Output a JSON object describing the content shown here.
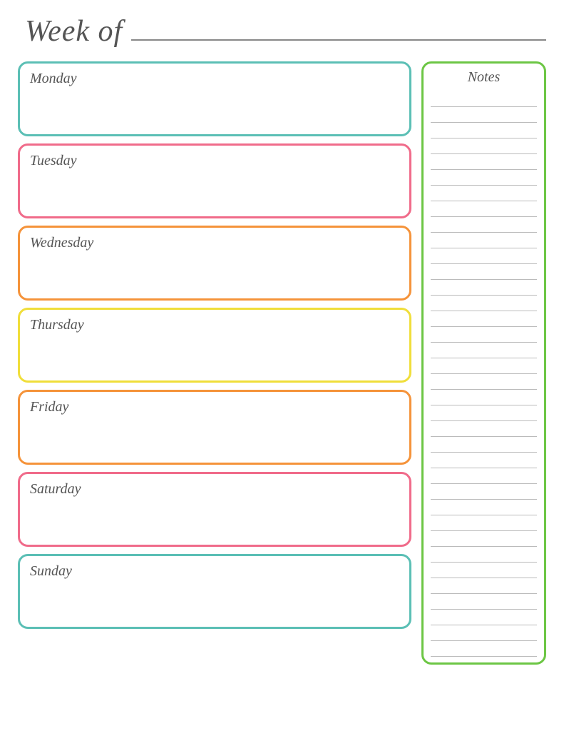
{
  "header": {
    "title": "Week of",
    "line": true
  },
  "days": [
    {
      "id": "monday",
      "label": "Monday",
      "class": "monday"
    },
    {
      "id": "tuesday",
      "label": "Tuesday",
      "class": "tuesday"
    },
    {
      "id": "wednesday",
      "label": "Wednesday",
      "class": "wednesday"
    },
    {
      "id": "thursday",
      "label": "Thursday",
      "class": "thursday"
    },
    {
      "id": "friday",
      "label": "Friday",
      "class": "friday"
    },
    {
      "id": "saturday",
      "label": "Saturday",
      "class": "saturday"
    },
    {
      "id": "sunday",
      "label": "Sunday",
      "class": "sunday"
    }
  ],
  "notes": {
    "title": "Notes",
    "line_count": 36
  }
}
